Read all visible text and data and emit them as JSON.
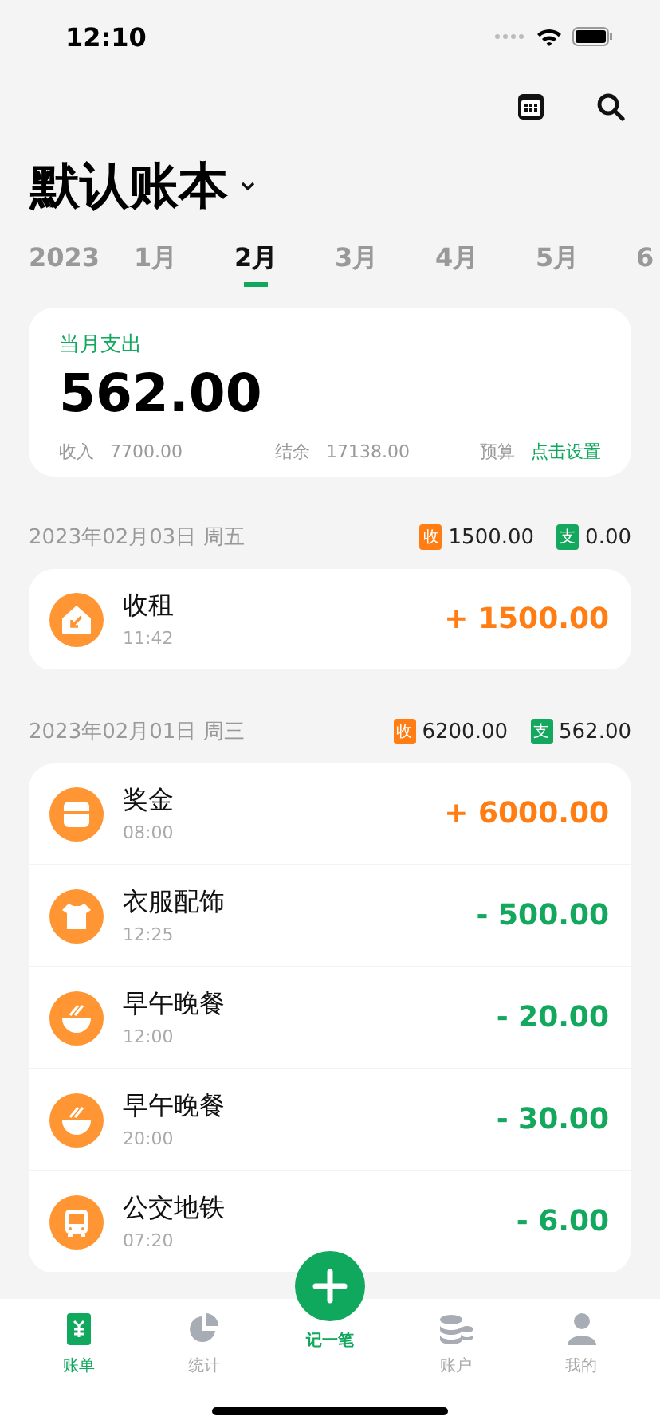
{
  "status_bar": {
    "time": "12:10"
  },
  "book": {
    "title": "默认账本"
  },
  "months": [
    {
      "label": "2023",
      "selected": false
    },
    {
      "label": "1月",
      "selected": false
    },
    {
      "label": "2月",
      "selected": true
    },
    {
      "label": "3月",
      "selected": false
    },
    {
      "label": "4月",
      "selected": false
    },
    {
      "label": "5月",
      "selected": false
    },
    {
      "label": "6",
      "selected": false
    }
  ],
  "summary": {
    "label": "当月支出",
    "amount": "562.00",
    "income_label": "收入",
    "income": "7700.00",
    "balance_label": "结余",
    "balance": "17138.00",
    "budget_label": "预算",
    "budget_action": "点击设置"
  },
  "days": [
    {
      "date": "2023年02月03日 周五",
      "income_tag": "收",
      "income": "1500.00",
      "expense_tag": "支",
      "expense": "0.00",
      "entries": [
        {
          "kind": "house",
          "name": "收租",
          "time": "11:42",
          "amount": "+ 1500.00",
          "color": "#ff7d12"
        }
      ]
    },
    {
      "date": "2023年02月01日 周三",
      "income_tag": "收",
      "income": "6200.00",
      "expense_tag": "支",
      "expense": "562.00",
      "entries": [
        {
          "kind": "bag",
          "name": "奖金",
          "time": "08:00",
          "amount": "+ 6000.00",
          "color": "#ff7d12"
        },
        {
          "kind": "shirt",
          "name": "衣服配饰",
          "time": "12:25",
          "amount": "- 500.00",
          "color": "#14a85e"
        },
        {
          "kind": "bowl",
          "name": "早午晚餐",
          "time": "12:00",
          "amount": "- 20.00",
          "color": "#14a85e"
        },
        {
          "kind": "bowl",
          "name": "早午晚餐",
          "time": "20:00",
          "amount": "- 30.00",
          "color": "#14a85e"
        },
        {
          "kind": "bus",
          "name": "公交地铁",
          "time": "07:20",
          "amount": "- 6.00",
          "color": "#14a85e"
        }
      ]
    }
  ],
  "tab_bar": [
    {
      "kind": "bill",
      "label": "账单",
      "selected": true
    },
    {
      "kind": "chart",
      "label": "统计",
      "selected": false
    },
    {
      "kind": "add",
      "label": "记一笔"
    },
    {
      "kind": "account",
      "label": "账户",
      "selected": false
    },
    {
      "kind": "person",
      "label": "我的",
      "selected": false
    }
  ]
}
